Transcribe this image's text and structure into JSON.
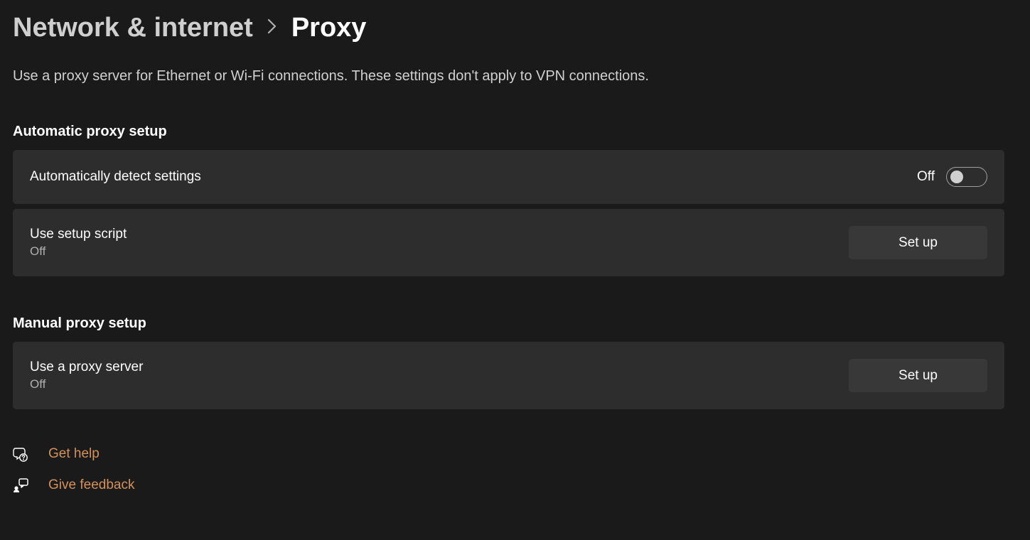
{
  "breadcrumb": {
    "parent": "Network & internet",
    "current": "Proxy"
  },
  "description": "Use a proxy server for Ethernet or Wi-Fi connections. These settings don't apply to VPN connections.",
  "sections": {
    "auto": {
      "header": "Automatic proxy setup",
      "detect": {
        "title": "Automatically detect settings",
        "state": "Off"
      },
      "script": {
        "title": "Use setup script",
        "sub": "Off",
        "button": "Set up"
      }
    },
    "manual": {
      "header": "Manual proxy setup",
      "server": {
        "title": "Use a proxy server",
        "sub": "Off",
        "button": "Set up"
      }
    }
  },
  "footer": {
    "help": "Get help",
    "feedback": "Give feedback"
  }
}
